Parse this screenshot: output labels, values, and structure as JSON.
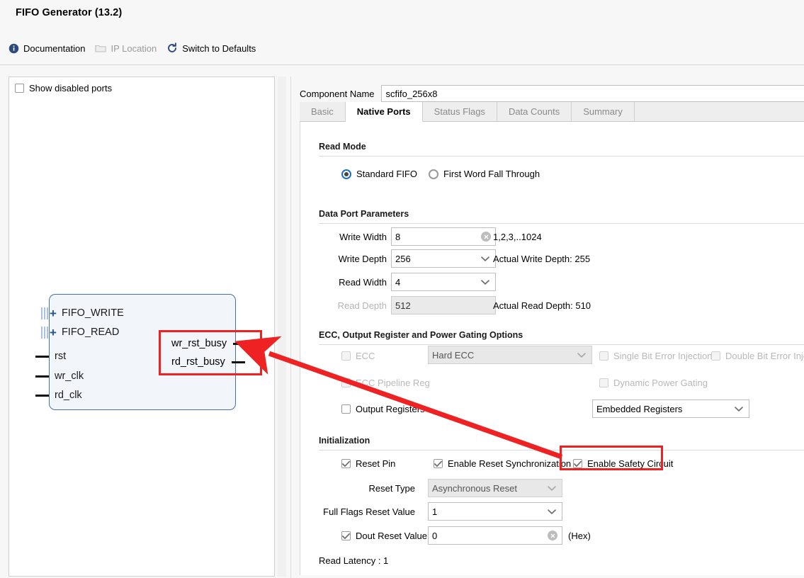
{
  "header": {
    "title": "FIFO Generator (13.2)",
    "links": [
      {
        "label": "Documentation",
        "icon": "info-icon",
        "enabled": true
      },
      {
        "label": "IP Location",
        "icon": "folder-icon",
        "enabled": false
      },
      {
        "label": "Switch to Defaults",
        "icon": "refresh-icon",
        "enabled": true
      }
    ]
  },
  "left_panel": {
    "show_disabled_ports": {
      "label": "Show disabled ports",
      "checked": false
    },
    "diagram": {
      "inputs": [
        {
          "label": "FIFO_WRITE",
          "type": "bus"
        },
        {
          "label": "FIFO_READ",
          "type": "bus"
        },
        {
          "label": "rst",
          "type": "pin"
        },
        {
          "label": "wr_clk",
          "type": "pin"
        },
        {
          "label": "rd_clk",
          "type": "pin"
        }
      ],
      "outputs": [
        {
          "label": "wr_rst_busy"
        },
        {
          "label": "rd_rst_busy"
        }
      ]
    }
  },
  "component_name": {
    "label": "Component Name",
    "value": "scfifo_256x8"
  },
  "tabs": [
    {
      "label": "Basic",
      "active": false
    },
    {
      "label": "Native Ports",
      "active": true
    },
    {
      "label": "Status Flags",
      "active": false
    },
    {
      "label": "Data Counts",
      "active": false
    },
    {
      "label": "Summary",
      "active": false
    }
  ],
  "read_mode": {
    "title": "Read Mode",
    "options": [
      {
        "label": "Standard FIFO",
        "selected": true
      },
      {
        "label": "First Word Fall Through",
        "selected": false
      }
    ]
  },
  "data_port_parameters": {
    "title": "Data Port Parameters",
    "write_width": {
      "label": "Write Width",
      "value": "8",
      "hint": "1,2,3,..1024",
      "enabled": true
    },
    "write_depth": {
      "label": "Write Depth",
      "value": "256",
      "hint": "Actual Write Depth: 255",
      "enabled": true
    },
    "read_width": {
      "label": "Read Width",
      "value": "4",
      "hint": "",
      "enabled": true
    },
    "read_depth": {
      "label": "Read Depth",
      "value": "512",
      "hint": "Actual Read Depth: 510",
      "enabled": false
    }
  },
  "ecc_section": {
    "title": "ECC, Output Register and Power Gating Options",
    "ecc": {
      "label": "ECC",
      "checked": false,
      "enabled": false
    },
    "ecc_mode": {
      "value": "Hard ECC",
      "enabled": false
    },
    "single_bit_error_injection": {
      "label": "Single Bit Error Injection",
      "checked": false,
      "enabled": false
    },
    "double_bit_error_injection": {
      "label": "Double Bit Error Injection",
      "checked": false,
      "enabled": false
    },
    "ecc_pipeline_reg": {
      "label": "ECC Pipeline Reg",
      "checked": false,
      "enabled": false
    },
    "dynamic_power_gating": {
      "label": "Dynamic Power Gating",
      "checked": false,
      "enabled": false
    },
    "output_registers": {
      "label": "Output Registers",
      "checked": false,
      "enabled": true
    },
    "register_type": {
      "value": "Embedded Registers",
      "enabled": true
    }
  },
  "initialization": {
    "title": "Initialization",
    "reset_pin": {
      "label": "Reset Pin",
      "checked": true
    },
    "enable_reset_synchronization": {
      "label": "Enable Reset Synchronization",
      "checked": true
    },
    "enable_safety_circuit": {
      "label": "Enable Safety Circuit",
      "checked": true
    },
    "reset_type": {
      "label": "Reset Type",
      "value": "Asynchronous Reset",
      "enabled": false
    },
    "full_flags_reset_value": {
      "label": "Full Flags Reset Value",
      "value": "1",
      "enabled": true
    },
    "dout_reset_value": {
      "label": "Dout Reset Value",
      "checked": true,
      "value": "0",
      "suffix": "(Hex)"
    },
    "read_latency": "Read Latency : 1"
  },
  "annotations": {
    "highlight_color": "#ee2222",
    "arrow_color": "#ee2222"
  }
}
